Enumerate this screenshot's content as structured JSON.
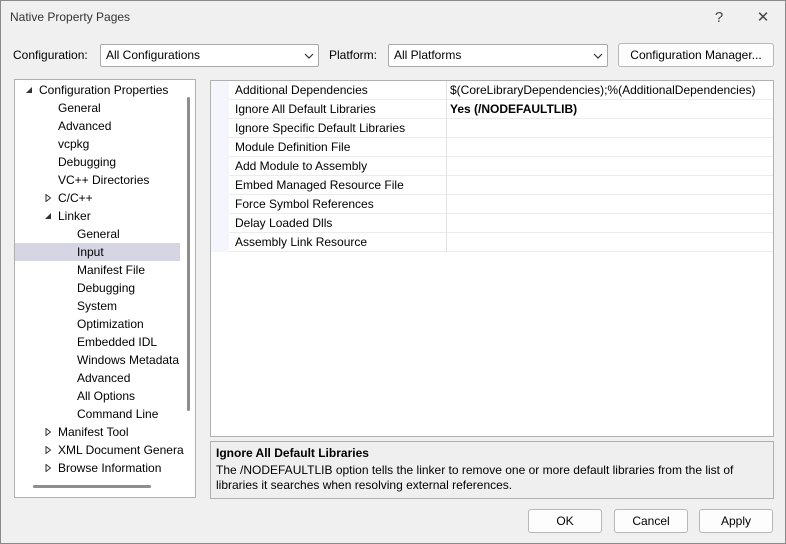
{
  "window": {
    "title": "Native Property Pages"
  },
  "titlebar": {
    "help_glyph": "?",
    "close_glyph": "✕"
  },
  "header": {
    "configuration_label": "Configuration:",
    "configuration_value": "All Configurations",
    "platform_label": "Platform:",
    "platform_value": "All Platforms",
    "config_manager_label": "Configuration Manager..."
  },
  "tree": {
    "items": [
      {
        "label": "Configuration Properties",
        "expander": "expanded"
      },
      {
        "label": "General"
      },
      {
        "label": "Advanced"
      },
      {
        "label": "vcpkg"
      },
      {
        "label": "Debugging"
      },
      {
        "label": "VC++ Directories"
      },
      {
        "label": "C/C++",
        "expander": "collapsed"
      },
      {
        "label": "Linker",
        "expander": "expanded"
      },
      {
        "label": "General"
      },
      {
        "label": "Input",
        "selected": true
      },
      {
        "label": "Manifest File"
      },
      {
        "label": "Debugging"
      },
      {
        "label": "System"
      },
      {
        "label": "Optimization"
      },
      {
        "label": "Embedded IDL"
      },
      {
        "label": "Windows Metadata"
      },
      {
        "label": "Advanced"
      },
      {
        "label": "All Options"
      },
      {
        "label": "Command Line"
      },
      {
        "label": "Manifest Tool",
        "expander": "collapsed"
      },
      {
        "label": "XML Document Genera",
        "expander": "collapsed"
      },
      {
        "label": "Browse Information",
        "expander": "collapsed"
      }
    ]
  },
  "grid": {
    "rows": [
      {
        "name": "Additional Dependencies",
        "value": "$(CoreLibraryDependencies);%(AdditionalDependencies)"
      },
      {
        "name": "Ignore All Default Libraries",
        "value": "Yes (/NODEFAULTLIB)",
        "bold": true
      },
      {
        "name": "Ignore Specific Default Libraries",
        "value": ""
      },
      {
        "name": "Module Definition File",
        "value": ""
      },
      {
        "name": "Add Module to Assembly",
        "value": ""
      },
      {
        "name": "Embed Managed Resource File",
        "value": ""
      },
      {
        "name": "Force Symbol References",
        "value": ""
      },
      {
        "name": "Delay Loaded Dlls",
        "value": ""
      },
      {
        "name": "Assembly Link Resource",
        "value": ""
      }
    ]
  },
  "description": {
    "title": "Ignore All Default Libraries",
    "text": "The /NODEFAULTLIB option tells the linker to remove one or more default libraries from the list of libraries it searches when resolving external references."
  },
  "footer": {
    "ok_label": "OK",
    "cancel_label": "Cancel",
    "apply_label": "Apply"
  }
}
